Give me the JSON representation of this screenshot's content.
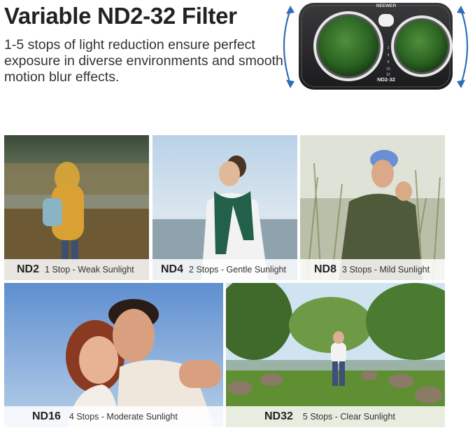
{
  "header": {
    "title": "Variable ND2-32 Filter",
    "subtitle": "1-5 stops of light reduction ensure perfect exposure in diverse environments and smooth motion blur effects."
  },
  "product": {
    "brand": "NEEWER",
    "model": "ND2-32",
    "scale": [
      "2",
      "4",
      "8",
      "16",
      "32"
    ],
    "rotate_icon": "rotate-arrows-icon"
  },
  "tiles": [
    {
      "name": "ND2",
      "desc": "1 Stop - Weak Sunlight"
    },
    {
      "name": "ND4",
      "desc": "2 Stops - Gentle Sunlight"
    },
    {
      "name": "ND8",
      "desc": "3 Stops - Mild Sunlight"
    },
    {
      "name": "ND16",
      "desc": "4 Stops - Moderate Sunlight"
    },
    {
      "name": "ND32",
      "desc": "5 Stops - Clear Sunlight"
    }
  ],
  "colors": {
    "lens_green": "#2f6b2a",
    "arrow_blue": "#2f6fb5",
    "caption_bg": "#ffffff"
  }
}
